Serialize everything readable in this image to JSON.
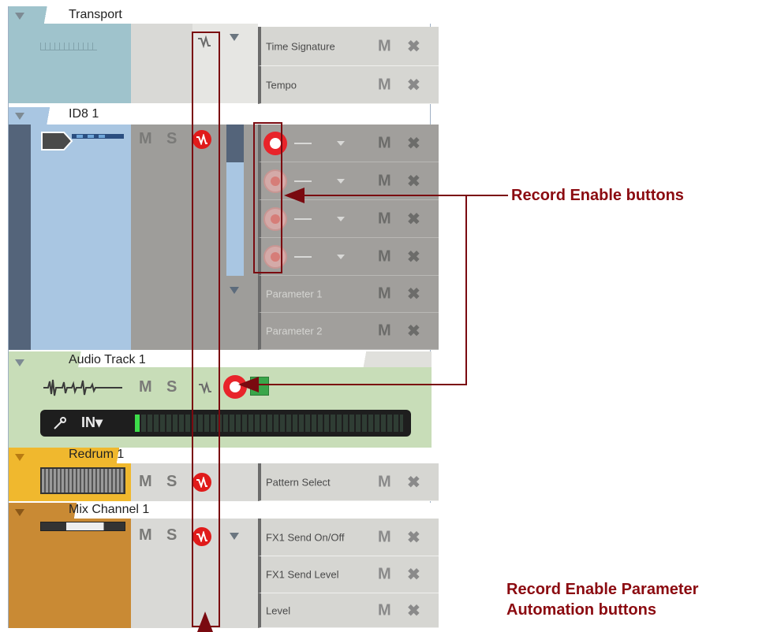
{
  "tracks": {
    "transport": {
      "name": "Transport"
    },
    "id8": {
      "name": "ID8 1"
    },
    "audio": {
      "name": "Audio Track 1",
      "input_label": "IN▾"
    },
    "redrum": {
      "name": "Redrum 1"
    },
    "mix": {
      "name": "Mix Channel 1"
    }
  },
  "buttons": {
    "mute": "M",
    "solo": "S",
    "delete": "✖"
  },
  "lanes": {
    "time_signature": "Time Signature",
    "tempo": "Tempo",
    "parameter_1": "Parameter 1",
    "parameter_2": "Parameter 2",
    "pattern_select": "Pattern Select",
    "fx1_send_onoff": "FX1 Send On/Off",
    "fx1_send_level": "FX1 Send Level",
    "level": "Level"
  },
  "callouts": {
    "record_enable": "Record Enable buttons",
    "automation_line1": "Record Enable Parameter",
    "automation_line2": "Automation buttons"
  },
  "colors": {
    "transport": "#9fc3cc",
    "id8": "#a9c6e2",
    "audio": "#c8ddb8",
    "redrum": "#f0b82e",
    "mix": "#c98a34",
    "record_red": "#e01b1b",
    "callout": "#8b0a10"
  },
  "icons": [
    "collapse-triangle-icon",
    "automation-wave-icon",
    "record-enable-icon",
    "monitor-icon",
    "input-jack-icon"
  ]
}
